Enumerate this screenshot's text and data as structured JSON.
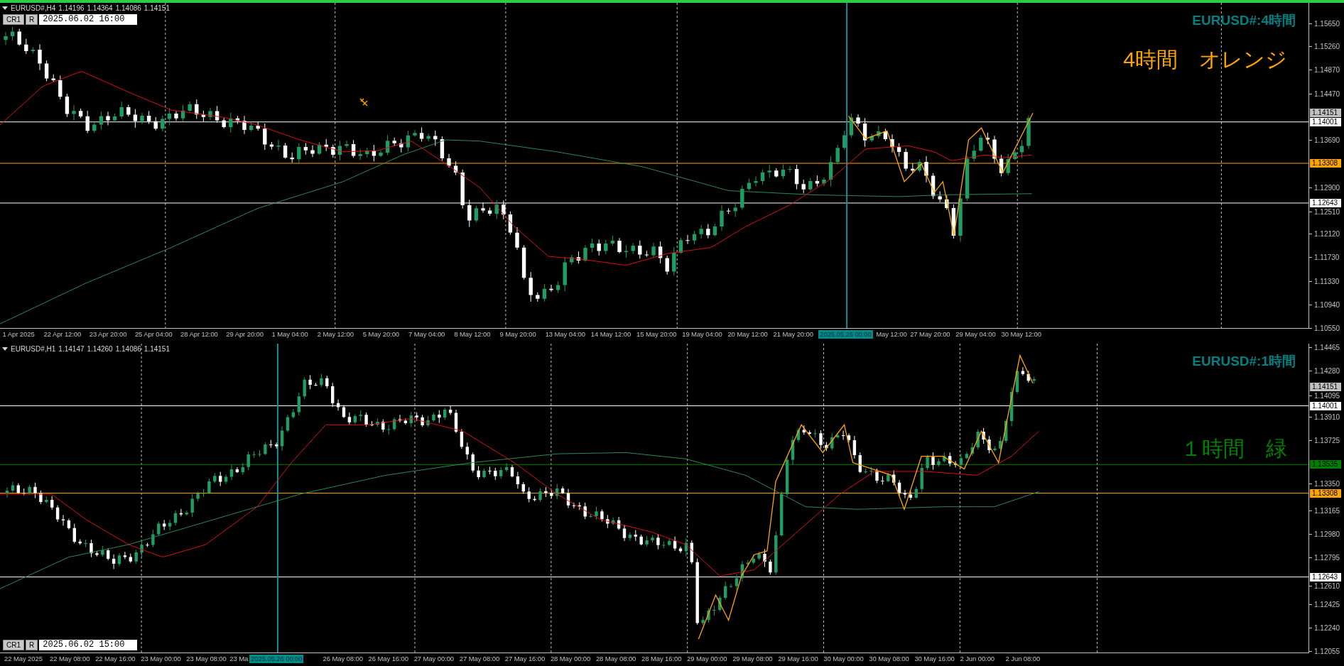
{
  "chart_panes": [
    {
      "kind": "upper",
      "symbol": "EURUSD#,H4",
      "ohlc": [
        "1.14196",
        "1.14364",
        "1.14086",
        "1.14151"
      ],
      "buttons": [
        "CR1",
        "R"
      ],
      "datetime": "2025.06.02 16:00",
      "title": "EURUSD#:4時間",
      "note": {
        "text": "4時間　オレンジ",
        "color": "#ffa500"
      },
      "price_ticks": [
        "1.15650",
        "1.15260",
        "1.14870",
        "1.14470",
        "1.13690",
        "1.12900",
        "1.12510",
        "1.12120",
        "1.11730",
        "1.11330",
        "1.10940",
        "1.10550"
      ],
      "price_labels": [
        {
          "text": "1.14151",
          "kind": "bid",
          "color": "#c0c0c0"
        },
        {
          "text": "1.14001",
          "kind": "line",
          "color": "#ffffff"
        },
        {
          "text": "1.13308",
          "kind": "line",
          "color": "#ffa500"
        },
        {
          "text": "1.12643",
          "kind": "line",
          "color": "#ffffff"
        }
      ],
      "time_labels": [
        {
          "text": "1 Apr 2025",
          "selected": false
        },
        {
          "text": "22 Apr 12:00",
          "selected": false
        },
        {
          "text": "23 Apr 20:00",
          "selected": false
        },
        {
          "text": "25 Apr 04:00",
          "selected": false
        },
        {
          "text": "28 Apr 12:00",
          "selected": false
        },
        {
          "text": "29 Apr 20:00",
          "selected": false
        },
        {
          "text": "1 May 04:00",
          "selected": false
        },
        {
          "text": "2 May 12:00",
          "selected": false
        },
        {
          "text": "5 May 20:00",
          "selected": false
        },
        {
          "text": "7 May 04:00",
          "selected": false
        },
        {
          "text": "8 May 12:00",
          "selected": false
        },
        {
          "text": "9 May 20:00",
          "selected": false
        },
        {
          "text": "13 May 04:00",
          "selected": false
        },
        {
          "text": "14 May 12:00",
          "selected": false
        },
        {
          "text": "15 May 20:00",
          "selected": false
        },
        {
          "text": "19 May 04:00",
          "selected": false
        },
        {
          "text": "20 May 12:00",
          "selected": false
        },
        {
          "text": "21 May 20:00",
          "selected": false
        },
        {
          "text": "2025.05.26 00:00",
          "selected": true
        },
        {
          "text": "May 12:00",
          "selected": false
        },
        {
          "text": "27 May 20:00",
          "selected": false
        },
        {
          "text": "29 May 04:00",
          "selected": false
        },
        {
          "text": "30 May 12:00",
          "selected": false
        }
      ]
    },
    {
      "kind": "lower",
      "symbol": "EURUSD#,H1",
      "ohlc": [
        "1.14147",
        "1.14260",
        "1.14086",
        "1.14151"
      ],
      "buttons": [
        "CR1",
        "R"
      ],
      "datetime": "2025.06.02 15:00",
      "title": "EURUSD#:1時間",
      "note": {
        "text": "１時間　緑",
        "color": "#008000"
      },
      "price_ticks": [
        "1.14465",
        "1.14280",
        "1.14095",
        "1.13910",
        "1.13725",
        "1.13350",
        "1.13165",
        "1.12980",
        "1.12795",
        "1.12610",
        "1.12425",
        "1.12240",
        "1.12055"
      ],
      "price_labels": [
        {
          "text": "1.14151",
          "kind": "bid",
          "color": "#c0c0c0"
        },
        {
          "text": "1.14001",
          "kind": "line",
          "color": "#ffffff"
        },
        {
          "text": "1.13535",
          "kind": "line",
          "color": "#008000"
        },
        {
          "text": "1.13308",
          "kind": "line",
          "color": "#ffa500"
        },
        {
          "text": "1.12643",
          "kind": "line",
          "color": "#ffffff"
        }
      ],
      "time_labels": [
        {
          "text": "22 May 2025",
          "selected": false
        },
        {
          "text": "22 May 08:00",
          "selected": false
        },
        {
          "text": "22 May 16:00",
          "selected": false
        },
        {
          "text": "23 May 00:00",
          "selected": false
        },
        {
          "text": "23 May 08:00",
          "selected": false
        },
        {
          "text": "23 Ma",
          "selected": false
        },
        {
          "text": "2025.05.26 00:00",
          "selected": true
        },
        {
          "text": "26 May 08:00",
          "selected": false
        },
        {
          "text": "26 May 16:00",
          "selected": false
        },
        {
          "text": "27 May 00:00",
          "selected": false
        },
        {
          "text": "27 May 08:00",
          "selected": false
        },
        {
          "text": "27 May 16:00",
          "selected": false
        },
        {
          "text": "28 May 00:00",
          "selected": false
        },
        {
          "text": "28 May 08:00",
          "selected": false
        },
        {
          "text": "28 May 16:00",
          "selected": false
        },
        {
          "text": "29 May 00:00",
          "selected": false
        },
        {
          "text": "29 May 08:00",
          "selected": false
        },
        {
          "text": "29 May 16:00",
          "selected": false
        },
        {
          "text": "30 May 00:00",
          "selected": false
        },
        {
          "text": "30 May 08:00",
          "selected": false
        },
        {
          "text": "30 May 16:00",
          "selected": false
        },
        {
          "text": "2 Jun 00:00",
          "selected": false
        },
        {
          "text": "2 Jun 08:00",
          "selected": false
        }
      ]
    }
  ]
}
